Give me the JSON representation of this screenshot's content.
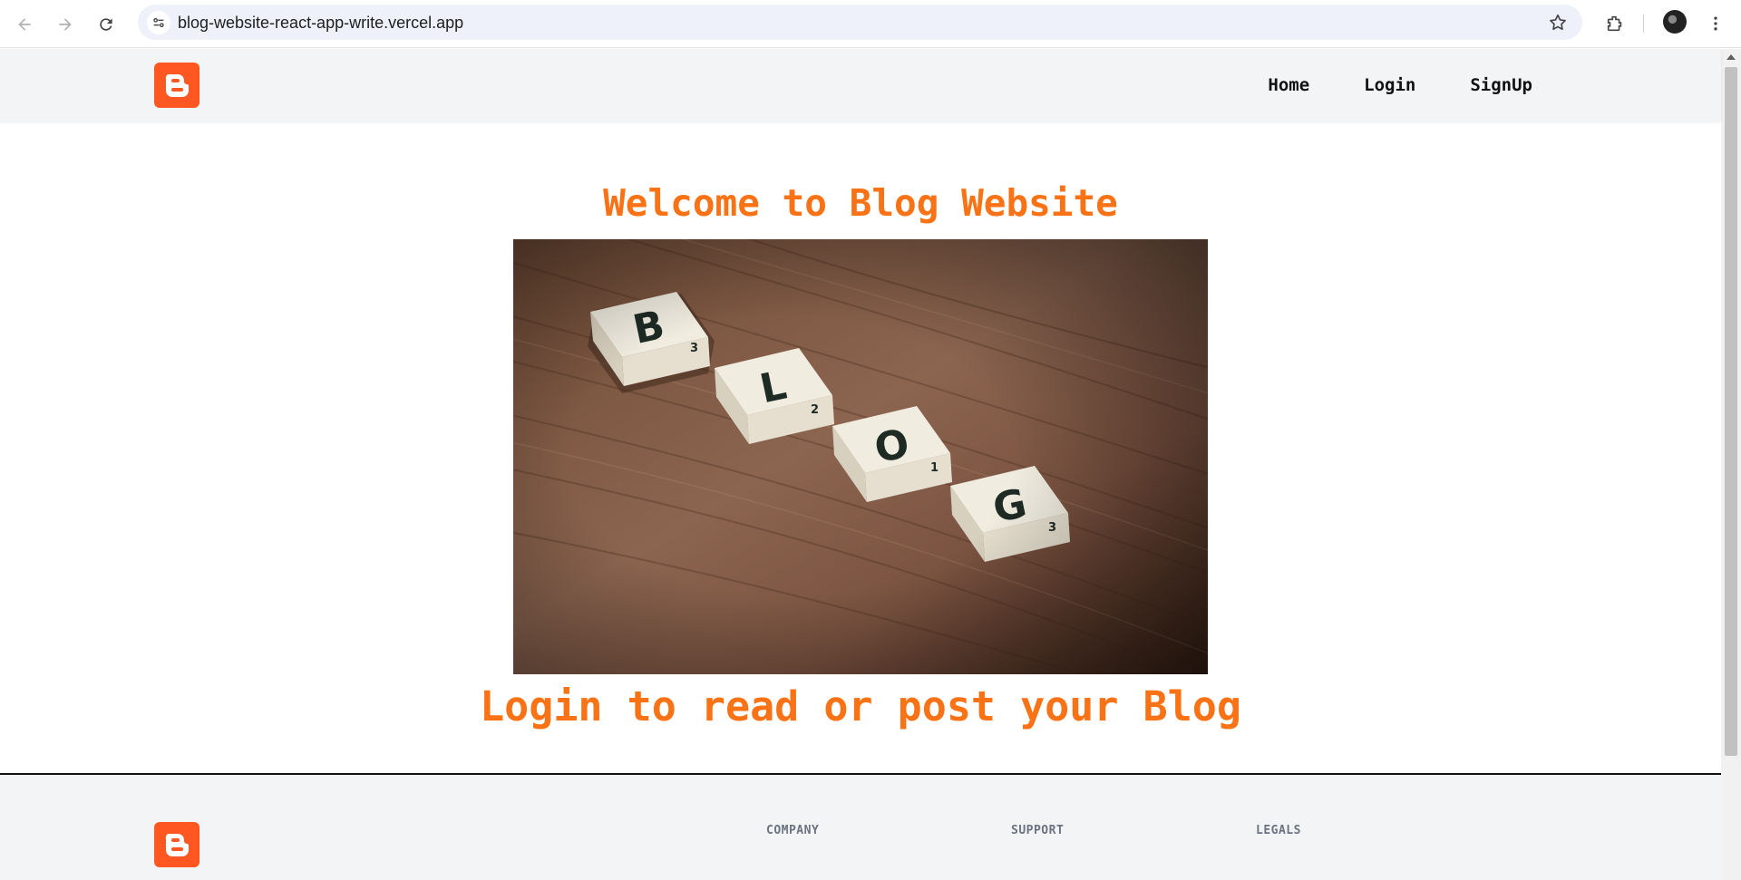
{
  "browser": {
    "url": "blog-website-react-app-write.vercel.app",
    "icons": [
      "back-arrow-icon",
      "forward-arrow-icon",
      "reload-icon",
      "site-settings-icon",
      "bookmark-star-icon",
      "extensions-icon",
      "profile-avatar",
      "more-menu-icon"
    ]
  },
  "header": {
    "logo": "blogger-logo-icon",
    "nav": [
      {
        "label": "Home"
      },
      {
        "label": "Login"
      },
      {
        "label": "SignUp"
      }
    ]
  },
  "main": {
    "title": "Welcome to Blog Website",
    "subtitle": "Login to read or post your Blog",
    "image_tiles": [
      {
        "letter": "B",
        "score": "3"
      },
      {
        "letter": "L",
        "score": "2"
      },
      {
        "letter": "O",
        "score": "1"
      },
      {
        "letter": "G",
        "score": "3"
      }
    ]
  },
  "footer": {
    "columns": [
      {
        "heading": "COMPANY"
      },
      {
        "heading": "SUPPORT"
      },
      {
        "heading": "LEGALS"
      }
    ]
  },
  "colors": {
    "accent": "#f97316",
    "logo": "#ff5722",
    "header_bg": "#f3f4f6"
  }
}
